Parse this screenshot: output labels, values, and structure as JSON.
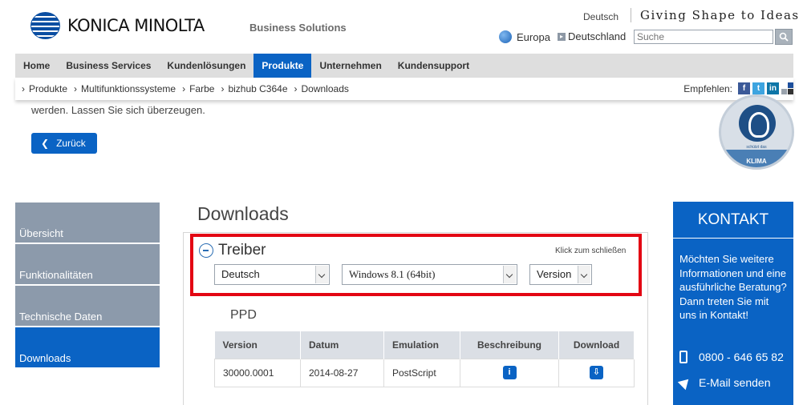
{
  "header": {
    "brand": "KONICA MINOLTA",
    "business_solutions": "Business Solutions",
    "language": "Deutsch",
    "tagline": "Giving Shape to Ideas",
    "region_europa": "Europa",
    "region_country": "Deutschland",
    "search_placeholder": "Suche"
  },
  "nav": {
    "items": [
      "Home",
      "Business Services",
      "Kundenlösungen",
      "Produkte",
      "Unternehmen",
      "Kundensupport"
    ],
    "active": "Produkte"
  },
  "breadcrumb": [
    "Produkte",
    "Multifunktionssysteme",
    "Farbe",
    "bizhub C364e",
    "Downloads"
  ],
  "share": {
    "label": "Empfehlen:"
  },
  "intro": {
    "text": "werden. Lassen Sie sich überzeugen.",
    "back_label": "Zurück"
  },
  "eco_badge": {
    "small_text": "schützt das",
    "band_text": "KLIMA"
  },
  "sidebar": {
    "items": [
      "Übersicht",
      "Funktionalitäten",
      "Technische Daten",
      "Downloads"
    ],
    "active": "Downloads"
  },
  "downloads": {
    "title": "Downloads",
    "section_label": "Treiber",
    "close_hint": "Klick zum schließen",
    "language_select": "Deutsch",
    "os_select": "Windows 8.1 (64bit)",
    "version_select": "Version",
    "group_label": "PPD",
    "table": {
      "headers": [
        "Version",
        "Datum",
        "Emulation",
        "Beschreibung",
        "Download"
      ],
      "rows": [
        {
          "version": "30000.0001",
          "datum": "2014-08-27",
          "emulation": "PostScript"
        }
      ]
    }
  },
  "contact": {
    "title": "KONTAKT",
    "text": "Möchten Sie weitere Informationen und eine ausführliche Beratung? Dann treten Sie mit uns in Kontakt!",
    "phone": "0800 - 646 65 82",
    "email_label": "E-Mail senden"
  },
  "colors": {
    "brand_blue": "#0a63c4",
    "highlight_red": "#e30613",
    "sidebar_grey": "#8c9aab"
  }
}
